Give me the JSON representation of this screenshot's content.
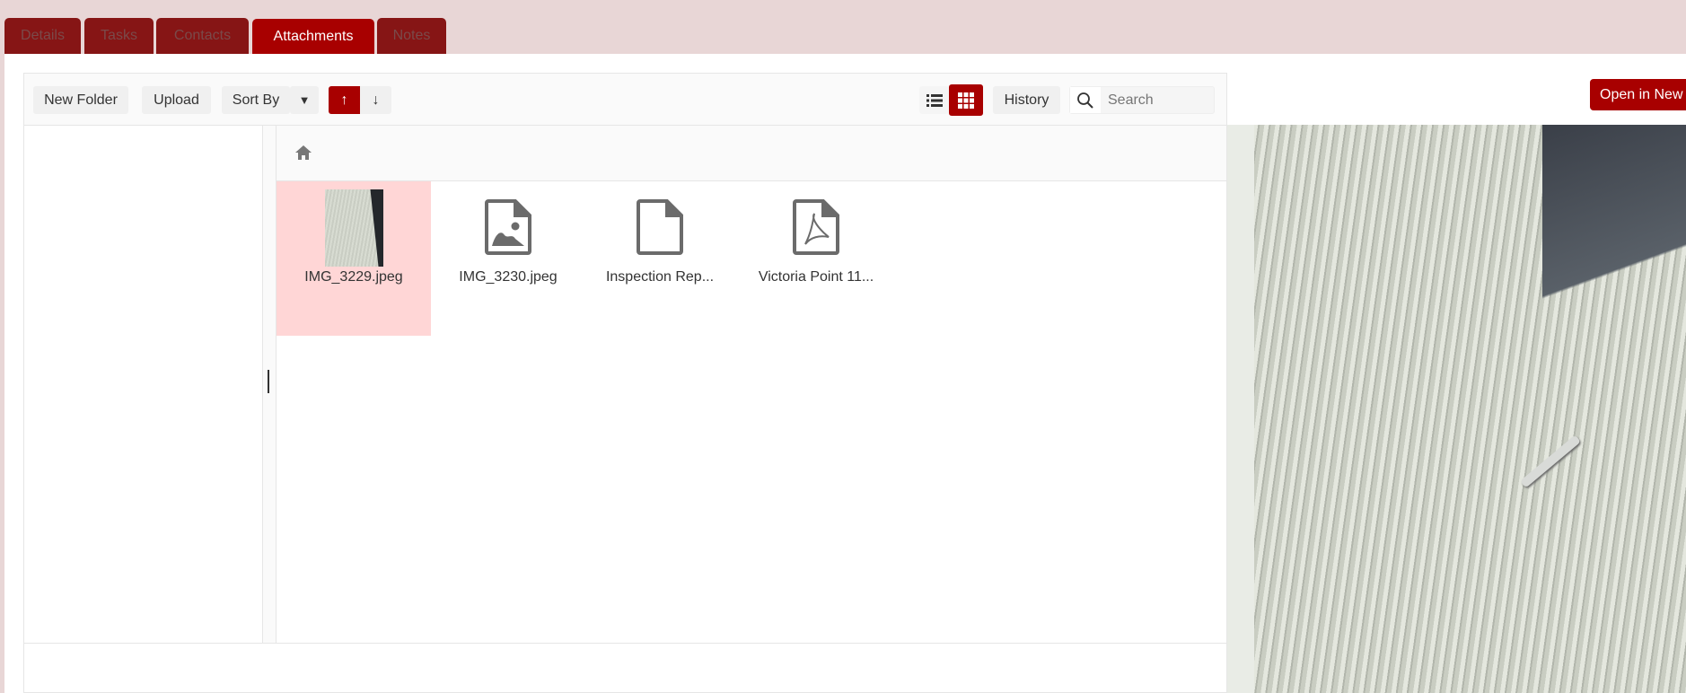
{
  "tabs": [
    {
      "label": "Details"
    },
    {
      "label": "Tasks"
    },
    {
      "label": "Contacts"
    },
    {
      "label": "Attachments",
      "active": true
    },
    {
      "label": "Notes"
    }
  ],
  "toolbar": {
    "new_folder": "New Folder",
    "upload": "Upload",
    "sort_by": "Sort By",
    "sort_ascending_icon": "arrow-up-icon",
    "sort_descending_icon": "arrow-down-icon",
    "history": "History",
    "search_placeholder": "Search",
    "view_mode": "grid"
  },
  "breadcrumb": {
    "icon": "home-icon"
  },
  "files": [
    {
      "name": "IMG_3229.jpeg",
      "type": "image-thumbnail",
      "selected": true
    },
    {
      "name": "IMG_3230.jpeg",
      "type": "image-file-icon"
    },
    {
      "name": "Inspection Rep...",
      "type": "file-icon"
    },
    {
      "name": "Victoria Point 11...",
      "type": "pdf-icon"
    }
  ],
  "preview": {
    "open_button": "Open in New"
  },
  "colors": {
    "accent": "#a80000",
    "tab_inactive": "#861515",
    "selected_tile": "#ffd6d6",
    "background": "#e8d6d6"
  }
}
